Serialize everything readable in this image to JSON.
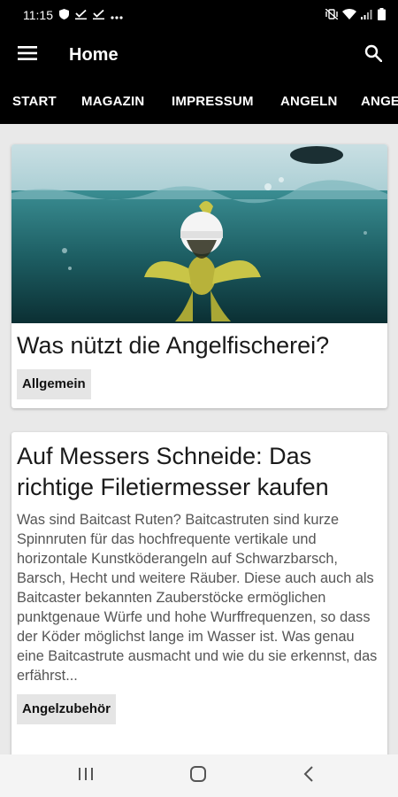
{
  "status_bar": {
    "time": "11:15",
    "left_icons": [
      "shield-icon",
      "download-check-icon",
      "download-check-icon",
      "more-dots-icon"
    ],
    "right_icons": [
      "mute-vibrate-icon",
      "wifi-icon",
      "signal-icon",
      "battery-icon"
    ]
  },
  "app_bar": {
    "title": "Home",
    "menu_icon": "hamburger-menu-icon",
    "search_icon": "search-icon"
  },
  "nav_tabs": [
    "START",
    "MAGAZIN",
    "IMPRESSUM",
    "ANGELN",
    "ANGE"
  ],
  "articles": [
    {
      "title": "Was nützt die Angelfischerei?",
      "category": "Allgemein",
      "has_image": true
    },
    {
      "title": "Auf Messers Schneide: Das richtige Filetiermesser kaufen",
      "excerpt": "Was sind Baitcast Ruten? Baitcastruten sind kurze Spinnruten für das hochfrequente vertikale und horizontale Kunstköderangeln auf Schwarzbarsch, Barsch, Hecht und weitere Räuber. Diese auch auch als Baitcaster bekannten Zauberstöcke ermöglichen punktgenaue Würfe und hohe Wurffrequenzen, so dass der Köder möglichst lange im Wasser ist. Was genau eine Baitcastrute ausmacht und wie du sie erkennst, das erfährst...",
      "category": "Angelzubehör"
    }
  ],
  "bottom_nav": [
    "recent-apps-icon",
    "home-icon",
    "back-icon"
  ],
  "colors": {
    "bar_background": "#000000",
    "page_background": "#e9e9e9",
    "card_background": "#ffffff",
    "chip_background": "#e5e5e5"
  }
}
